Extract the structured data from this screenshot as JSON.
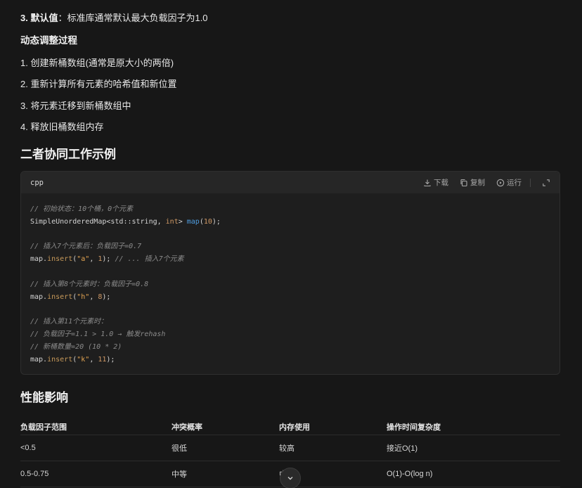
{
  "intro": {
    "default_label": "3. 默认值",
    "default_text": "：标准库通常默认最大负载因子为1.0",
    "dynamic_heading": "动态调整过程",
    "steps": [
      "1. 创建新桶数组(通常是原大小的两倍)",
      "2. 重新计算所有元素的哈希值和新位置",
      "3. 将元素迁移到新桶数组中",
      "4. 释放旧桶数组内存"
    ]
  },
  "example_heading": "二者协同工作示例",
  "code": {
    "language": "cpp",
    "actions": {
      "download": "下载",
      "copy": "复制",
      "run": "运行"
    },
    "lines": {
      "l1": "// 初始状态：10个桶，0个元素",
      "l2a": "SimpleUnorderedMap<std::string, ",
      "l2b": "int",
      "l2c": "> ",
      "l2d": "map",
      "l2e": "(",
      "l2f": "10",
      "l2g": ");",
      "l4": "// 插入7个元素后：负载因子=0.7",
      "l5a": "map.",
      "l5b": "insert",
      "l5c": "(",
      "l5d": "\"a\"",
      "l5e": ", ",
      "l5f": "1",
      "l5g": "); ",
      "l5h": "// ... 插入7个元素",
      "l7": "// 插入第8个元素时：负载因子=0.8",
      "l8a": "map.",
      "l8b": "insert",
      "l8c": "(",
      "l8d": "\"h\"",
      "l8e": ", ",
      "l8f": "8",
      "l8g": ");",
      "l10": "// 插入第11个元素时：",
      "l11": "// 负载因子=1.1 > 1.0 → 触发rehash",
      "l12": "// 新桶数量=20 (10 * 2)",
      "l13a": "map.",
      "l13b": "insert",
      "l13c": "(",
      "l13d": "\"k\"",
      "l13e": ", ",
      "l13f": "11",
      "l13g": ");"
    }
  },
  "perf_heading": "性能影响",
  "table": {
    "headers": [
      "负载因子范围",
      "冲突概率",
      "内存使用",
      "操作时间复杂度"
    ],
    "rows": [
      [
        "<0.5",
        "很低",
        "较高",
        "接近O(1)"
      ],
      [
        "0.5-0.75",
        "中等",
        "中",
        "O(1)-O(log n)"
      ]
    ]
  },
  "icons": {
    "download": "download-icon",
    "copy": "copy-icon",
    "run": "play-icon",
    "expand": "expand-icon",
    "scroll": "chevron-down-icon"
  }
}
